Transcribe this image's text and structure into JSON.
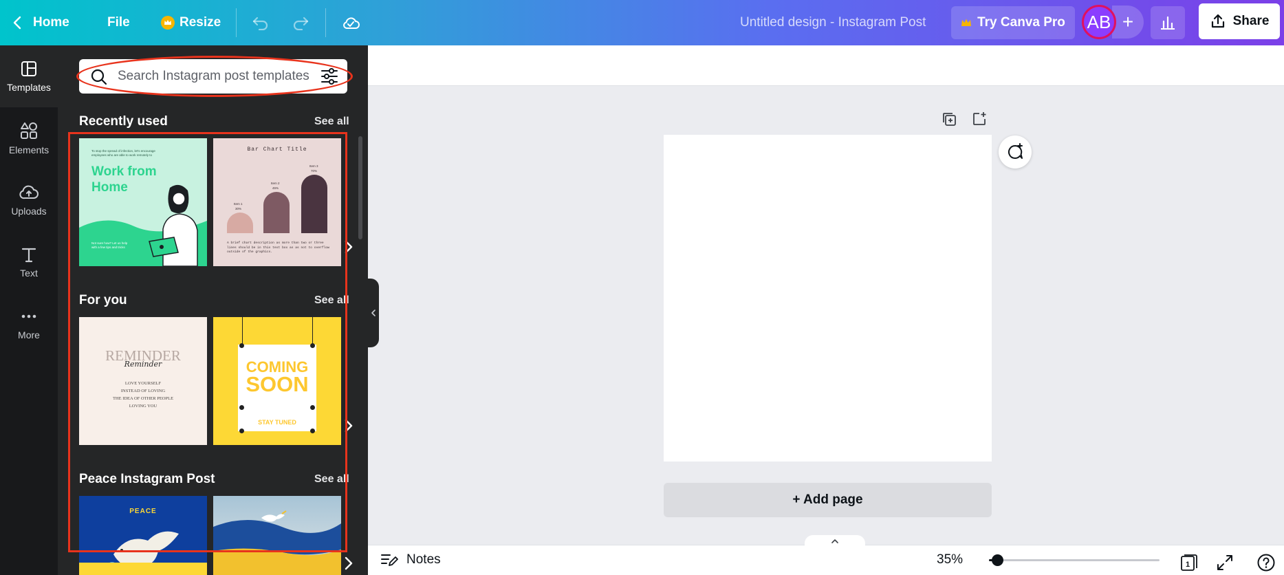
{
  "topbar": {
    "home_label": "Home",
    "file_label": "File",
    "resize_label": "Resize",
    "design_title": "Untitled design - Instagram Post",
    "try_pro_label": "Try Canva Pro",
    "avatar_initials": "AB",
    "share_label": "Share"
  },
  "rail": {
    "items": [
      {
        "label": "Templates",
        "icon": "templates-icon",
        "active": true
      },
      {
        "label": "Elements",
        "icon": "elements-icon"
      },
      {
        "label": "Uploads",
        "icon": "uploads-icon"
      },
      {
        "label": "Text",
        "icon": "text-icon"
      },
      {
        "label": "More",
        "icon": "more-icon"
      }
    ]
  },
  "panel": {
    "search_placeholder": "Search Instagram post templates",
    "sections": [
      {
        "title": "Recently used",
        "see_all": "See all"
      },
      {
        "title": "For you",
        "see_all": "See all"
      },
      {
        "title": "Peace Instagram Post",
        "see_all": "See all"
      }
    ],
    "thumbs": {
      "wfh": {
        "small_text": "To stop the spread of infection, let's encourage employees who are able to work remotely to",
        "line1": "Work from",
        "line2": "Home",
        "footer": "Not sure how? Let us help with a few tips and tricks"
      },
      "bar": {
        "title": "Bar Chart Title",
        "item1": "Item 1",
        "item1_val": "30%",
        "item2": "Item 2",
        "item2_val": "45%",
        "item3": "Item 3",
        "item3_val": "70%",
        "desc": "A brief chart description as more than two or three lines should be in this text box as as not to overflow outside of the graphics."
      },
      "reminder": {
        "title": "REMINDER",
        "script": "Reminder",
        "body": "LOVE YOURSELF\nINSTEAD OF LOVING\nTHE IDEA OF OTHER PEOPLE\nLOVING YOU"
      },
      "coming": {
        "line1": "COMING",
        "line2": "SOON",
        "sub": "STAY TUNED"
      },
      "peace": {
        "title": "PEACE"
      }
    }
  },
  "canvas": {
    "add_page_label": "+ Add page"
  },
  "bottombar": {
    "notes_label": "Notes",
    "zoom_label": "35%",
    "zoom_value": 0.05,
    "page_count": "1"
  },
  "colors": {
    "accent_red": "#e8331c",
    "brand_purple": "#8b3dff",
    "wfh_green": "#2dd48f",
    "coming_yellow": "#fdd835",
    "peace_blue": "#0e3f9e"
  }
}
